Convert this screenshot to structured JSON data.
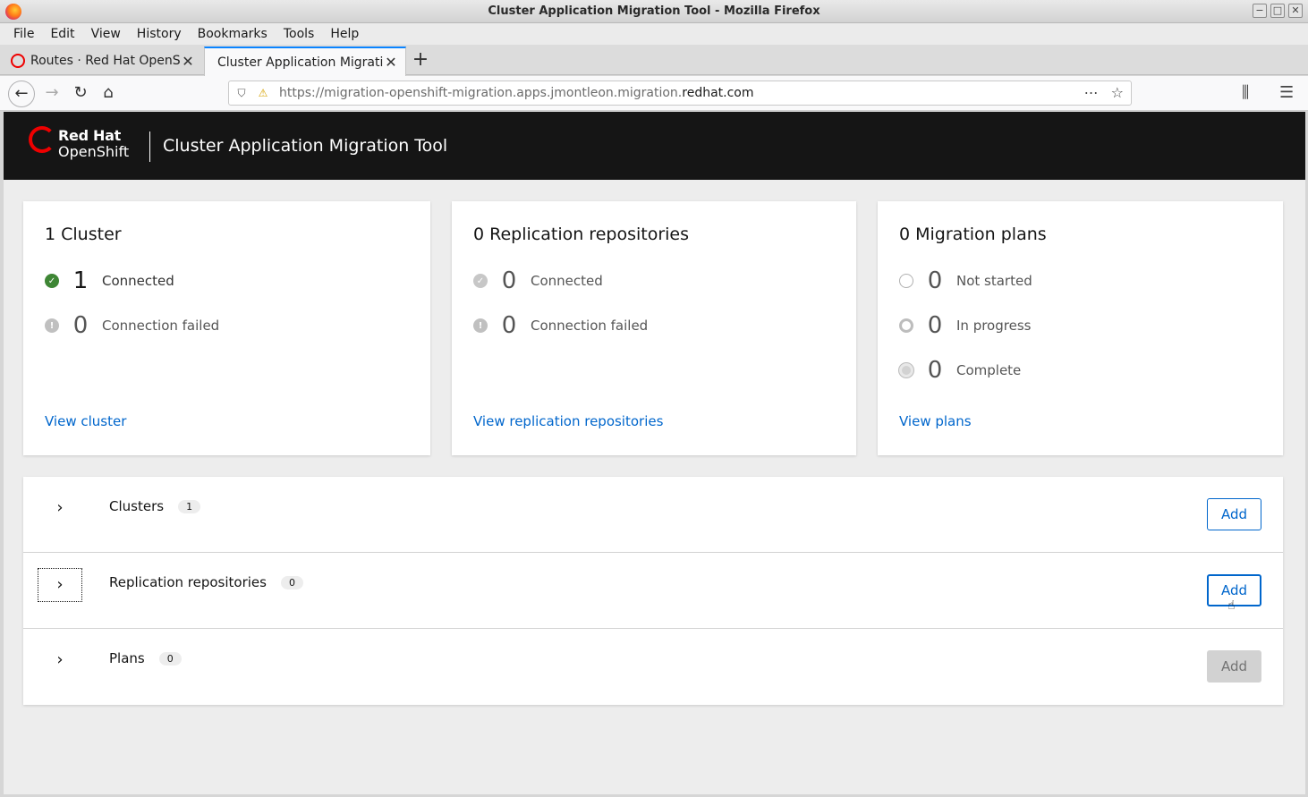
{
  "window": {
    "title": "Cluster Application Migration Tool - Mozilla Firefox",
    "controls": [
      "−",
      "□",
      "✕"
    ]
  },
  "menubar": [
    "File",
    "Edit",
    "View",
    "History",
    "Bookmarks",
    "Tools",
    "Help"
  ],
  "tabs": [
    {
      "label": "Routes · Red Hat OpenSh",
      "active": false
    },
    {
      "label": "Cluster Application Migratio",
      "active": true
    }
  ],
  "nav": {
    "url_prefix": "https://migration-openshift-migration.apps.jmontleon.migration.",
    "url_domain": "redhat.com"
  },
  "masthead": {
    "brand_line1": "Red Hat",
    "brand_line2": "OpenShift",
    "title": "Cluster Application Migration Tool"
  },
  "cards": [
    {
      "title": "1 Cluster",
      "stats": [
        {
          "value": "1",
          "label": "Connected",
          "icon": "check-circle-icon"
        },
        {
          "value": "0",
          "label": "Connection failed",
          "icon": "exclamation-circle-icon"
        }
      ],
      "link": "View cluster"
    },
    {
      "title": "0 Replication repositories",
      "stats": [
        {
          "value": "0",
          "label": "Connected",
          "icon": "check-circle-icon"
        },
        {
          "value": "0",
          "label": "Connection failed",
          "icon": "exclamation-circle-icon"
        }
      ],
      "link": "View replication repositories"
    },
    {
      "title": "0 Migration plans",
      "stats": [
        {
          "value": "0",
          "label": "Not started",
          "icon": "not-started-icon"
        },
        {
          "value": "0",
          "label": "In progress",
          "icon": "in-progress-icon"
        },
        {
          "value": "0",
          "label": "Complete",
          "icon": "complete-icon"
        }
      ],
      "link": "View plans"
    }
  ],
  "accordion": [
    {
      "title": "Clusters",
      "count": "1",
      "button": "Add",
      "button_state": "enabled"
    },
    {
      "title": "Replication repositories",
      "count": "0",
      "button": "Add",
      "button_state": "focused"
    },
    {
      "title": "Plans",
      "count": "0",
      "button": "Add",
      "button_state": "disabled"
    }
  ],
  "colors": {
    "brand_red": "#ee0000",
    "link_blue": "#0066cc",
    "success_green": "#3e8635",
    "masthead_bg": "#151515"
  }
}
